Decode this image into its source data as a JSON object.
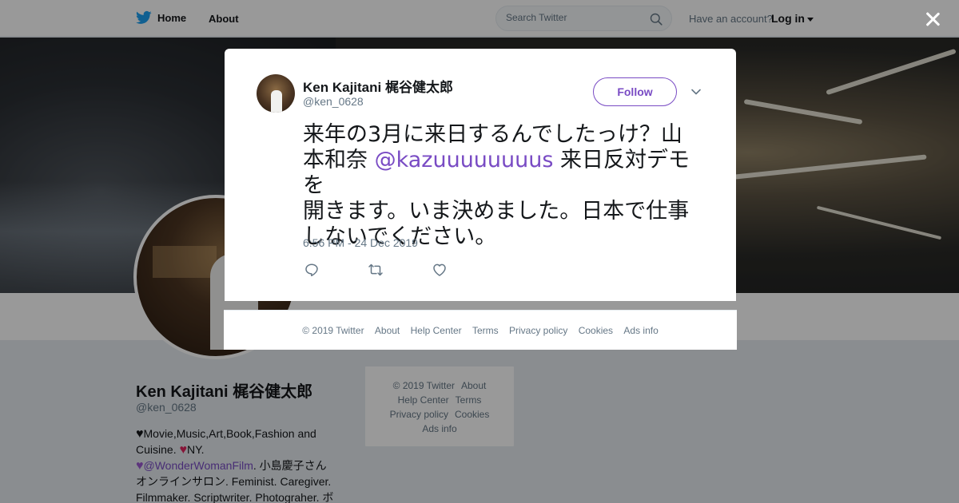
{
  "topbar": {
    "home": "Home",
    "about": "About",
    "search_placeholder": "Search Twitter",
    "have_account": "Have an account?",
    "login": "Log in"
  },
  "profile": {
    "name": "Ken Kajitani 梶谷健太郎",
    "handle": "@ken_0628",
    "bio_line1": "Movie,Music,Art,Book,Fashion and",
    "bio_line2_a": "Cuisine. ",
    "bio_line2_b": "NY.",
    "bio_link": "@WonderWomanFilm",
    "bio_line3_rest": ". 小島慶子さん",
    "bio_line4": "オンラインサロン. Feminist. Caregiver.",
    "bio_line5": "Filmmaker. Scriptwriter. Photograher. ボ"
  },
  "side_footer": {
    "copyright": "© 2019 Twitter",
    "about": "About",
    "help": "Help Center",
    "terms": "Terms",
    "privacy": "Privacy policy",
    "cookies": "Cookies",
    "ads": "Ads info"
  },
  "tweet": {
    "name": "Ken Kajitani 梶谷健太郎",
    "handle": "@ken_0628",
    "follow_label": "Follow",
    "text_line1": "来年の3月に来日するんでしたっけ？山",
    "text_line2_a": "本和奈 ",
    "mention": "@kazuuuuuuuus",
    "text_line2_b": " 来日反対デモを",
    "text_line3": "開きます。いま決めました。日本で仕事",
    "text_line4": "しないでください。",
    "timestamp": "6:56 PM - 24 Dec 2019"
  },
  "modal_footer": {
    "copyright": "© 2019 Twitter",
    "about": "About",
    "help": "Help Center",
    "terms": "Terms",
    "privacy": "Privacy policy",
    "cookies": "Cookies",
    "ads": "Ads info"
  },
  "colors": {
    "accent": "#794bc4",
    "twitter_blue": "#1da1f2",
    "secondary_text": "#657786"
  },
  "icons": [
    "twitter-bird-icon",
    "search-icon",
    "caret-down-icon",
    "close-icon",
    "chevron-down-icon",
    "reply-icon",
    "retweet-icon",
    "like-icon",
    "black-heart-icon",
    "red-heart-icon",
    "purple-heart-icon"
  ]
}
